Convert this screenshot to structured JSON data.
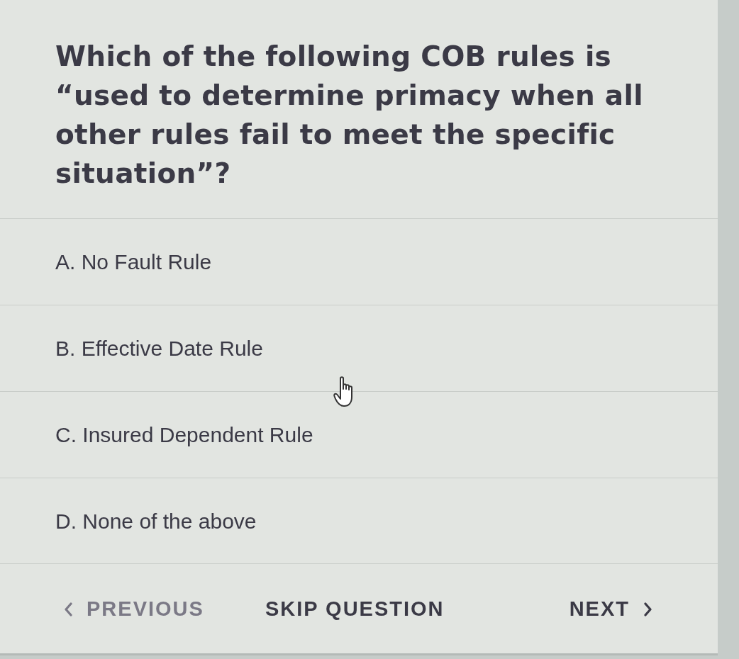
{
  "question": {
    "text": "Which of the following COB rules is “used to determine primacy when all other rules fail to meet the specific situation”?"
  },
  "options": [
    {
      "label": "A. No Fault Rule",
      "selected": false
    },
    {
      "label": "B. Effective Date Rule",
      "selected": false
    },
    {
      "label": "C. Insured Dependent Rule",
      "selected": false
    },
    {
      "label": "D. None of the above",
      "selected": false
    }
  ],
  "navigation": [
    {
      "kind": "previous",
      "label": "PREVIOUS",
      "disabled": true
    },
    {
      "kind": "skip",
      "label": "SKIP QUESTION",
      "disabled": false
    },
    {
      "kind": "next",
      "label": "NEXT",
      "disabled": false
    }
  ]
}
